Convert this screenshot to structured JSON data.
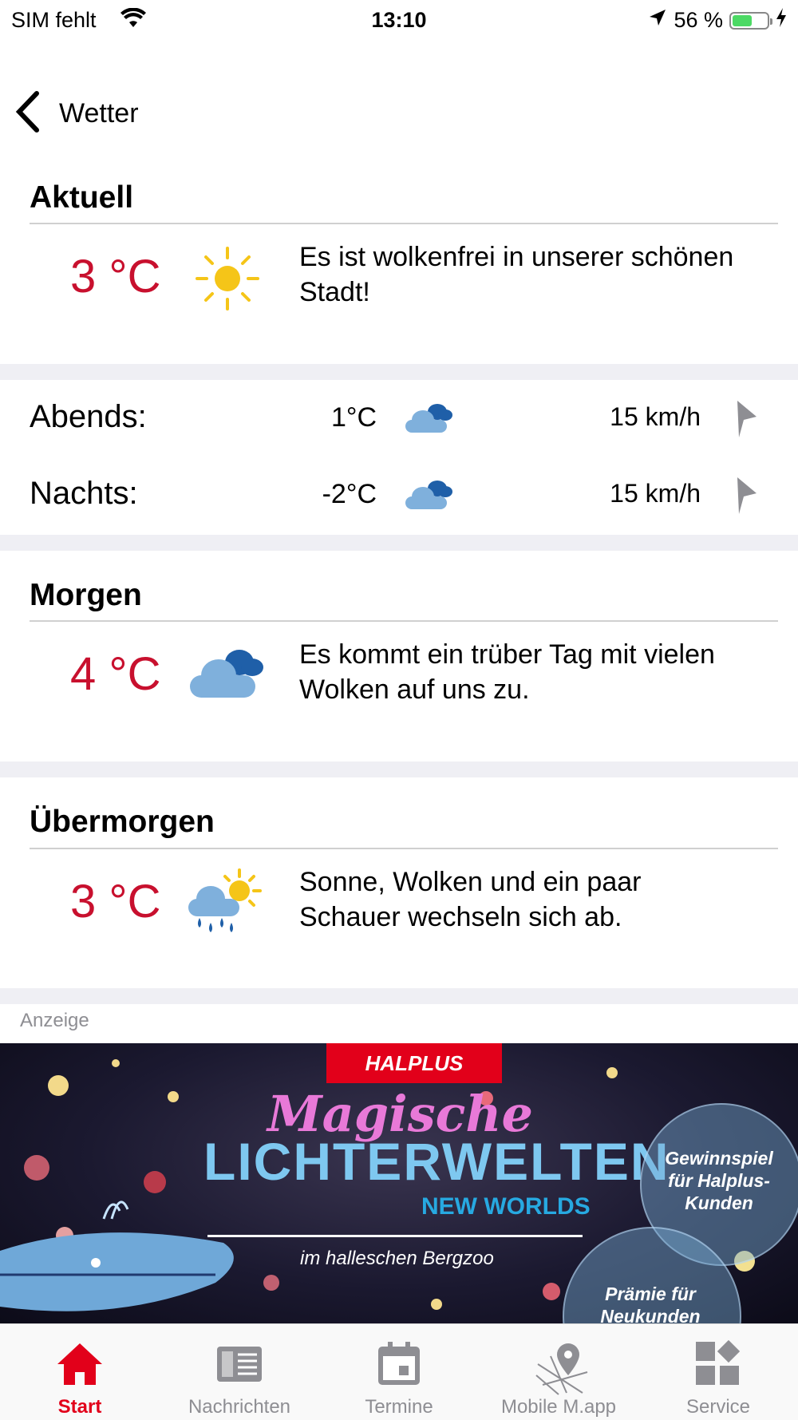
{
  "status_bar": {
    "carrier": "SIM fehlt",
    "time": "13:10",
    "battery": "56 %",
    "battery_level": 0.56
  },
  "nav": {
    "back_label": "Wetter"
  },
  "current": {
    "title": "Aktuell",
    "temp": "3 °C",
    "icon": "sun-icon",
    "description": "Es ist wolkenfrei in unserer schönen Stadt!"
  },
  "periods": [
    {
      "label": "Abends:",
      "temp": "1°C",
      "icon": "cloud-icon",
      "wind": "15 km/h",
      "wind_icon": "wind-direction-icon"
    },
    {
      "label": "Nachts:",
      "temp": "-2°C",
      "icon": "cloud-icon",
      "wind": "15 km/h",
      "wind_icon": "wind-direction-icon"
    }
  ],
  "tomorrow": {
    "title": "Morgen",
    "temp": "4 °C",
    "icon": "cloudy-icon",
    "description": "Es kommt ein trüber Tag mit vielen Wolken auf uns zu."
  },
  "day_after": {
    "title": "Übermorgen",
    "temp": "3 °C",
    "icon": "sun-rain-cloud-icon",
    "description": "Sonne, Wolken und ein paar Schauer wechseln sich ab."
  },
  "ad": {
    "label": "Anzeige",
    "brand": "HALPLUS",
    "headline1": "Magische",
    "headline2": "LICHTERWELTEN",
    "headline3": "NEW WORLDS",
    "subline": "im halleschen Bergzoo",
    "bubble1": "Gewinnspiel für Halplus-Kunden",
    "bubble2": "Prämie für Neukunden"
  },
  "tabs": [
    {
      "label": "Start",
      "icon": "home-icon",
      "active": true
    },
    {
      "label": "Nachrichten",
      "icon": "news-icon",
      "active": false
    },
    {
      "label": "Termine",
      "icon": "calendar-icon",
      "active": false
    },
    {
      "label": "Mobile M.app",
      "icon": "map-icon",
      "active": false
    },
    {
      "label": "Service",
      "icon": "service-grid-icon",
      "active": false
    }
  ],
  "colors": {
    "accent": "#e2001a",
    "temp": "#c8102e",
    "separator": "#efeff4",
    "cloud_light": "#7fb0dc",
    "cloud_dark": "#1f5fa8",
    "sun": "#f5c518"
  }
}
